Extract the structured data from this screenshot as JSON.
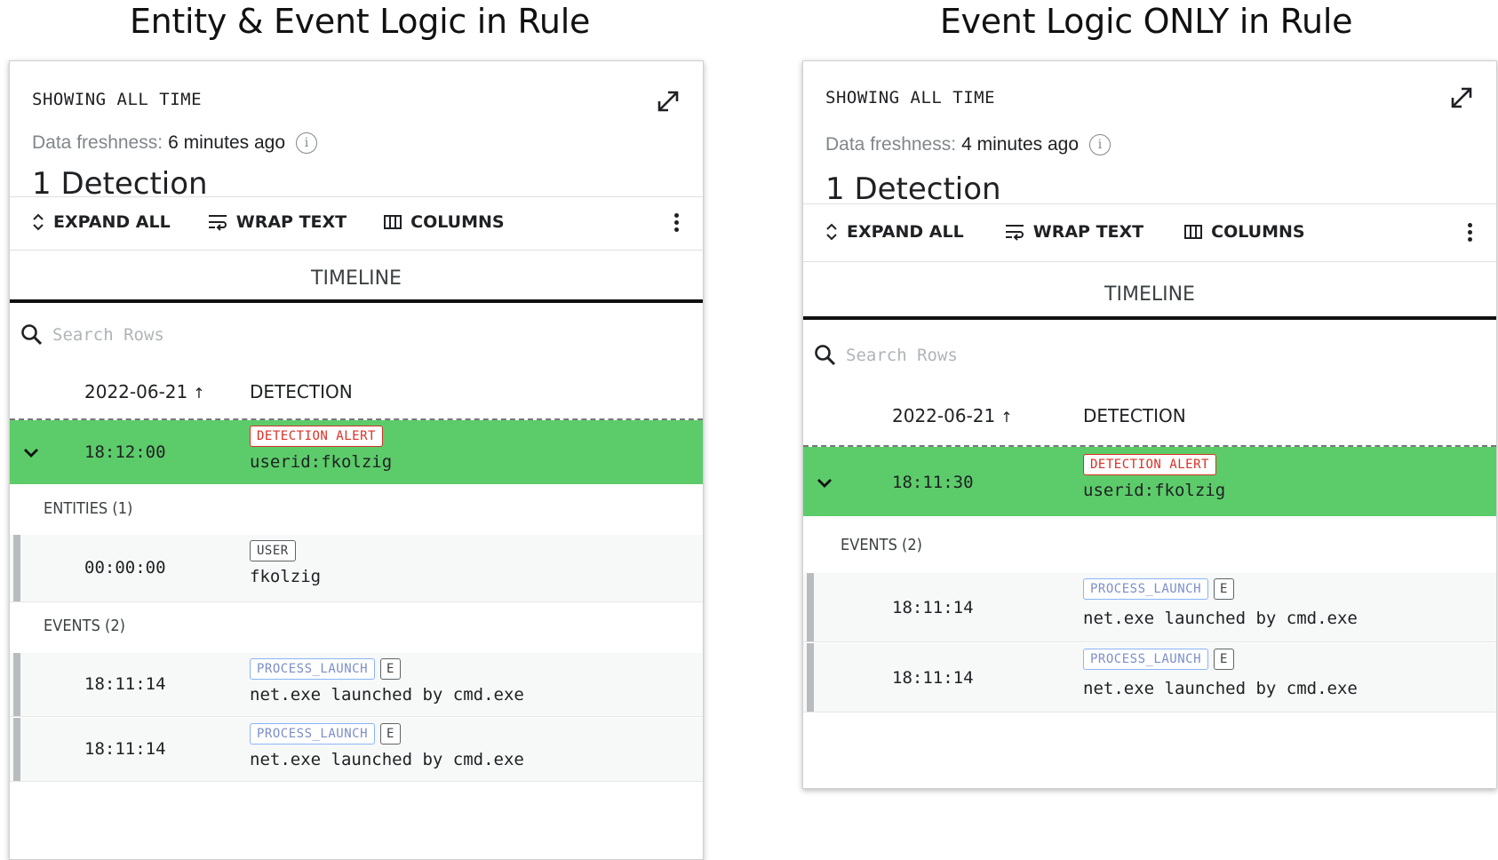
{
  "headings": {
    "left": "Entity & Event Logic in Rule",
    "right": "Event Logic ONLY in Rule"
  },
  "common": {
    "showing": "SHOWING ALL TIME",
    "freshness_label": "Data freshness:",
    "detection_count": "1 Detection",
    "toolbar": {
      "expand_all": "EXPAND ALL",
      "wrap_text": "WRAP TEXT",
      "columns": "COLUMNS"
    },
    "tab_timeline": "TIMELINE",
    "search_placeholder": "Search Rows",
    "col_date": "2022-06-21",
    "col_date_sort": "↑",
    "col_detection": "DETECTION",
    "alert_badge": "DETECTION ALERT",
    "icons": [
      "expand-diagonal-icon",
      "info-icon",
      "unfold-icon",
      "wrap-text-icon",
      "columns-icon",
      "kebab-menu-icon",
      "search-icon",
      "chevron-down-icon"
    ]
  },
  "left": {
    "freshness_value": "6 minutes ago",
    "detection": {
      "time": "18:12:00",
      "value": "userid:fkolzig"
    },
    "entities_label": "ENTITIES (1)",
    "entities": [
      {
        "time": "00:00:00",
        "badge": "USER",
        "value": "fkolzig"
      }
    ],
    "events_label": "EVENTS (2)",
    "events": [
      {
        "time": "18:11:14",
        "badge": "PROCESS_LAUNCH",
        "tag": "E",
        "value": "net.exe launched by cmd.exe"
      },
      {
        "time": "18:11:14",
        "badge": "PROCESS_LAUNCH",
        "tag": "E",
        "value": "net.exe launched by cmd.exe"
      }
    ]
  },
  "right": {
    "freshness_value": "4 minutes ago",
    "detection": {
      "time": "18:11:30",
      "value": "userid:fkolzig"
    },
    "events_label": "EVENTS (2)",
    "events": [
      {
        "time": "18:11:14",
        "badge": "PROCESS_LAUNCH",
        "tag": "E",
        "value": "net.exe launched by cmd.exe"
      },
      {
        "time": "18:11:14",
        "badge": "PROCESS_LAUNCH",
        "tag": "E",
        "value": "net.exe launched by cmd.exe"
      }
    ]
  },
  "colors": {
    "detection_row": "#5ccc6a",
    "alert_red": "#d93025",
    "process_badge_blue": "#8ab4f8"
  }
}
